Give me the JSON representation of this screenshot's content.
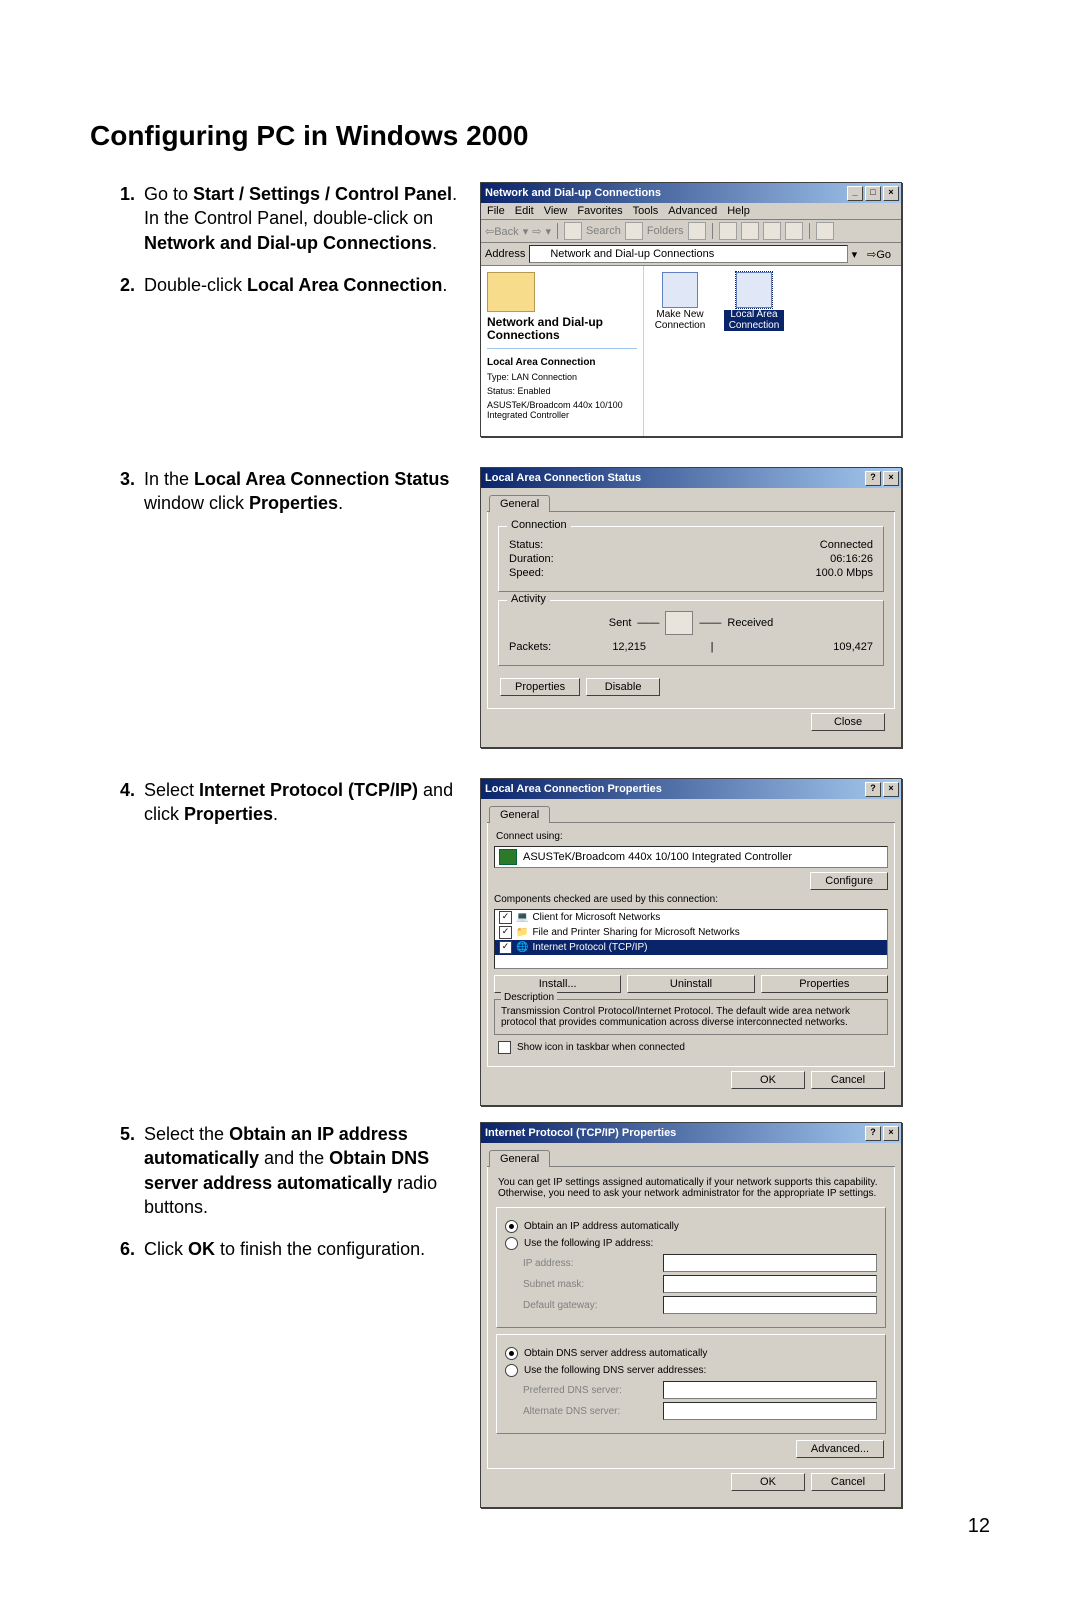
{
  "page": {
    "title": "Configuring PC in Windows 2000",
    "number": "12"
  },
  "steps": {
    "s1a": "Go to ",
    "s1b": "Start / Settings / Control Panel",
    "s1c": ". In the Control Panel, double-click on ",
    "s1d": "Network and Dial-up Connections",
    "s1e": ".",
    "s2a": "Double-click ",
    "s2b": "Local Area Connection",
    "s2c": ".",
    "s3a": "In the ",
    "s3b": "Local Area Connection Status",
    "s3c": " window click ",
    "s3d": "Properties",
    "s3e": ".",
    "s4a": "Select ",
    "s4b": "Internet Protocol (TCP/IP)",
    "s4c": " and click ",
    "s4d": "Properties",
    "s4e": ".",
    "s5a": "Select the ",
    "s5b": "Obtain an IP address automatically",
    "s5c": " and the ",
    "s5d": "Obtain DNS server address automatically",
    "s5e": " radio buttons.",
    "s6a": "Click ",
    "s6b": "OK",
    "s6c": " to finish the configuration."
  },
  "win1": {
    "title": "Network and Dial-up Connections",
    "menus": {
      "file": "File",
      "edit": "Edit",
      "view": "View",
      "fav": "Favorites",
      "tools": "Tools",
      "adv": "Advanced",
      "help": "Help"
    },
    "toolbar": {
      "back": "Back",
      "search": "Search",
      "folders": "Folders"
    },
    "address_label": "Address",
    "address_value": "Network and Dial-up Connections",
    "go": "Go",
    "left": {
      "title": "Network and Dial-up Connections",
      "sel": "Local Area Connection",
      "type": "Type: LAN Connection",
      "status": "Status: Enabled",
      "nic": "ASUSTeK/Broadcom 440x 10/100 Integrated Controller"
    },
    "items": {
      "makenew": "Make New Connection",
      "lac": "Local Area Connection"
    }
  },
  "win2": {
    "title": "Local Area Connection Status",
    "tab": "General",
    "grp_conn": "Connection",
    "status_l": "Status:",
    "status_v": "Connected",
    "duration_l": "Duration:",
    "duration_v": "06:16:26",
    "speed_l": "Speed:",
    "speed_v": "100.0 Mbps",
    "grp_act": "Activity",
    "sent": "Sent",
    "received": "Received",
    "packets_l": "Packets:",
    "packets_sent": "12,215",
    "packets_recv": "109,427",
    "btn_props": "Properties",
    "btn_disable": "Disable",
    "btn_close": "Close"
  },
  "win3": {
    "title": "Local Area Connection Properties",
    "tab": "General",
    "connect_using": "Connect using:",
    "nic": "ASUSTeK/Broadcom 440x 10/100 Integrated Controller",
    "configure": "Configure",
    "components_label": "Components checked are used by this connection:",
    "items": {
      "c1": "Client for Microsoft Networks",
      "c2": "File and Printer Sharing for Microsoft Networks",
      "c3": "Internet Protocol (TCP/IP)"
    },
    "install": "Install...",
    "uninstall": "Uninstall",
    "properties": "Properties",
    "desc_legend": "Description",
    "desc": "Transmission Control Protocol/Internet Protocol. The default wide area network protocol that provides communication across diverse interconnected networks.",
    "showicon": "Show icon in taskbar when connected",
    "ok": "OK",
    "cancel": "Cancel"
  },
  "win4": {
    "title": "Internet Protocol (TCP/IP) Properties",
    "tab": "General",
    "note": "You can get IP settings assigned automatically if your network supports this capability. Otherwise, you need to ask your network administrator for the appropriate IP settings.",
    "r1": "Obtain an IP address automatically",
    "r2": "Use the following IP address:",
    "ip_l": "IP address:",
    "mask_l": "Subnet mask:",
    "gw_l": "Default gateway:",
    "r3": "Obtain DNS server address automatically",
    "r4": "Use the following DNS server addresses:",
    "pdns_l": "Preferred DNS server:",
    "adns_l": "Alternate DNS server:",
    "advanced": "Advanced...",
    "ok": "OK",
    "cancel": "Cancel"
  }
}
